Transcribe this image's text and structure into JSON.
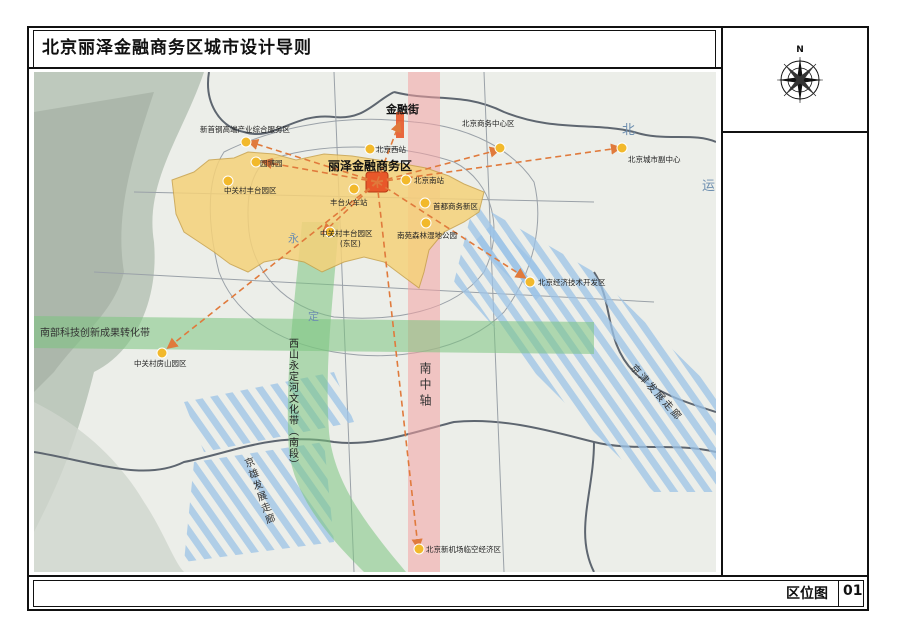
{
  "title": "北京丽泽金融商务区城市设计导则",
  "compass_label": "N",
  "footer": {
    "sheet_name": "区位图",
    "sheet_number": "01"
  },
  "map": {
    "labels": {
      "lize": "丽泽金融商务区",
      "jinrongjie": "金融街",
      "south_axis": "南中轴",
      "south_belt": "南部科技创新成果转化带",
      "xishan": "西山永定河文化带（南段）",
      "jingxiong": "京雄发展走廊",
      "jingjin": "京津发展走廊",
      "north_partial": "北",
      "yun_partial": "运",
      "yong_partial": "永",
      "ding_partial": "定"
    },
    "points": [
      {
        "id": "xinshougang",
        "label": "新首钢高端产业综合服务区"
      },
      {
        "id": "yuanboyuan",
        "label": "园博园"
      },
      {
        "id": "zgc_fengtai",
        "label": "中关村丰台园区"
      },
      {
        "id": "beijing_west",
        "label": "北京西站"
      },
      {
        "id": "beijing_cbd",
        "label": "北京商务中心区"
      },
      {
        "id": "beijing_south",
        "label": "北京南站"
      },
      {
        "id": "fengtai_station",
        "label": "丰台火车站"
      },
      {
        "id": "shoudu_business",
        "label": "首都商务新区"
      },
      {
        "id": "zgc_fengtai_east",
        "label": "中关村丰台园区"
      },
      {
        "id": "zgc_fengtai_east_sub",
        "label": "(东区)"
      },
      {
        "id": "nanyuan",
        "label": "南苑森林湿地公园"
      },
      {
        "id": "tongzhou",
        "label": "北京城市副中心"
      },
      {
        "id": "etown",
        "label": "北京经济技术开发区"
      },
      {
        "id": "fangshan",
        "label": "中关村房山园区"
      },
      {
        "id": "daxing_airport",
        "label": "北京新机场临空经济区"
      }
    ],
    "colors": {
      "focus_area": "#f5d27a",
      "focus_core": "#e8582a",
      "point": "#f2b92c",
      "arrow": "#e07a3c",
      "green_band": "#7bc47f",
      "pink_axis": "#f4a3a3",
      "blue_stripes": "#9cc3e6"
    }
  }
}
